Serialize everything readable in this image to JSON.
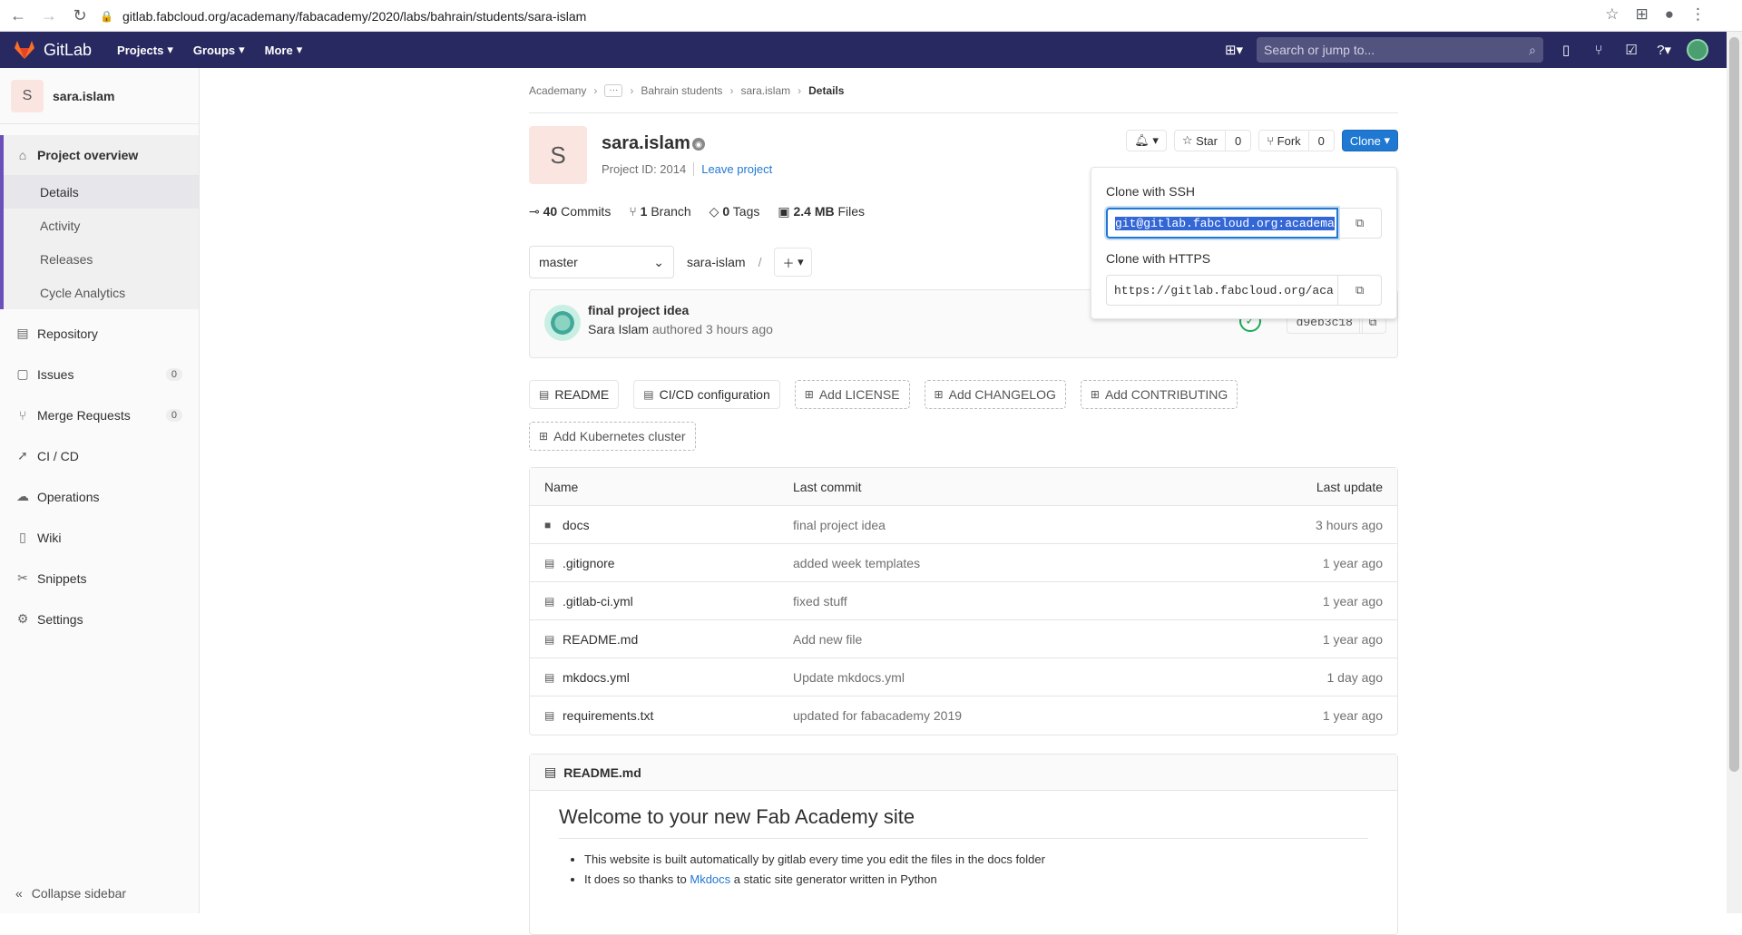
{
  "browser": {
    "url": "gitlab.fabcloud.org/academany/fabacademy/2020/labs/bahrain/students/sara-islam"
  },
  "topbar": {
    "brand": "GitLab",
    "nav": [
      "Projects",
      "Groups",
      "More"
    ],
    "search_placeholder": "Search or jump to..."
  },
  "sidebar": {
    "project_initial": "S",
    "project_name": "sara.islam",
    "overview": "Project overview",
    "overview_sub": [
      "Details",
      "Activity",
      "Releases",
      "Cycle Analytics"
    ],
    "items": [
      {
        "label": "Repository",
        "icon": "book-icon"
      },
      {
        "label": "Issues",
        "icon": "issues-icon",
        "badge": "0"
      },
      {
        "label": "Merge Requests",
        "icon": "merge-request-icon",
        "badge": "0"
      },
      {
        "label": "CI / CD",
        "icon": "rocket-icon"
      },
      {
        "label": "Operations",
        "icon": "cloud-gear-icon"
      },
      {
        "label": "Wiki",
        "icon": "book-open-icon"
      },
      {
        "label": "Snippets",
        "icon": "scissors-icon"
      },
      {
        "label": "Settings",
        "icon": "gear-icon"
      }
    ],
    "collapse": "Collapse sidebar"
  },
  "breadcrumb": {
    "items": [
      "Academany",
      "Bahrain students",
      "sara.islam",
      "Details"
    ]
  },
  "project": {
    "initial": "S",
    "name": "sara.islam",
    "id_text": "Project ID: 2014",
    "leave": "Leave project",
    "star_label": "Star",
    "star_count": "0",
    "fork_label": "Fork",
    "fork_count": "0",
    "clone_label": "Clone"
  },
  "stats": {
    "commits_num": "40",
    "commits_label": "Commits",
    "branch_num": "1",
    "branch_label": "Branch",
    "tags_num": "0",
    "tags_label": "Tags",
    "size_num": "2.4 MB",
    "size_label": "Files"
  },
  "controls": {
    "branch": "master",
    "path": "sara-islam",
    "path_sep": "/"
  },
  "last_commit": {
    "message": "final project idea",
    "author": "Sara Islam",
    "authored": "authored 3 hours ago",
    "sha": "d9eb3c18"
  },
  "quick_actions": {
    "readme": "README",
    "cicd": "CI/CD configuration",
    "license": "Add LICENSE",
    "changelog": "Add CHANGELOG",
    "contributing": "Add CONTRIBUTING",
    "kubernetes": "Add Kubernetes cluster"
  },
  "table": {
    "headers": [
      "Name",
      "Last commit",
      "Last update"
    ],
    "rows": [
      {
        "name": "docs",
        "type": "folder",
        "commit": "final project idea",
        "updated": "3 hours ago"
      },
      {
        "name": ".gitignore",
        "type": "file",
        "commit": "added week templates",
        "updated": "1 year ago"
      },
      {
        "name": ".gitlab-ci.yml",
        "type": "file",
        "commit": "fixed stuff",
        "updated": "1 year ago"
      },
      {
        "name": "README.md",
        "type": "file",
        "commit": "Add new file",
        "updated": "1 year ago"
      },
      {
        "name": "mkdocs.yml",
        "type": "file",
        "commit": "Update mkdocs.yml",
        "updated": "1 day ago"
      },
      {
        "name": "requirements.txt",
        "type": "file",
        "commit": "updated for fabacademy 2019",
        "updated": "1 year ago"
      }
    ]
  },
  "readme": {
    "file": "README.md",
    "heading": "Welcome to your new Fab Academy site",
    "bullet1": "This website is built automatically by gitlab every time you edit the files in the docs folder",
    "bullet2_pre": "It does so thanks to ",
    "bullet2_link": "Mkdocs",
    "bullet2_post": " a static site generator written in Python"
  },
  "clone_dropdown": {
    "ssh_label": "Clone with SSH",
    "ssh_url": "git@gitlab.fabcloud.org:academa",
    "https_label": "Clone with HTTPS",
    "https_url": "https://gitlab.fabcloud.org/aca"
  }
}
